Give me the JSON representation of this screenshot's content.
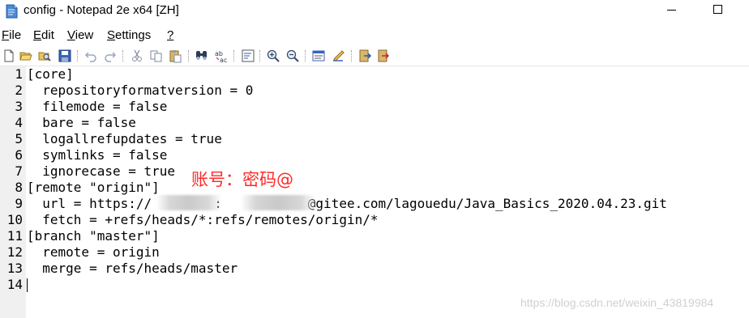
{
  "window": {
    "title": "config - Notepad 2e x64 [ZH]"
  },
  "menu": [
    {
      "label": "File",
      "accel": "F",
      "rest": "ile"
    },
    {
      "label": "Edit",
      "accel": "E",
      "rest": "dit"
    },
    {
      "label": "View",
      "accel": "V",
      "rest": "iew"
    },
    {
      "label": "Settings",
      "accel": "S",
      "rest": "ettings"
    },
    {
      "label": "?",
      "accel": "?",
      "rest": ""
    }
  ],
  "toolbar": [
    "new-file-icon",
    "open-file-icon",
    "browse-icon",
    "save-icon",
    "undo-icon",
    "redo-icon",
    "cut-icon",
    "copy-icon",
    "paste-icon",
    "find-icon",
    "replace-icon",
    "word-wrap-icon",
    "zoom-in-icon",
    "zoom-out-icon",
    "scheme-icon",
    "customize-scheme-icon",
    "exit-icon",
    "save-as-icon"
  ],
  "editor": {
    "lines": [
      {
        "n": "1",
        "text": "[core]"
      },
      {
        "n": "2",
        "text": "  repositoryformatversion = 0"
      },
      {
        "n": "3",
        "text": "  filemode = false"
      },
      {
        "n": "4",
        "text": "  bare = false"
      },
      {
        "n": "5",
        "text": "  logallrefupdates = true"
      },
      {
        "n": "6",
        "text": "  symlinks = false"
      },
      {
        "n": "7",
        "text": "  ignorecase = true"
      },
      {
        "n": "8",
        "text": "[remote \"origin\"]"
      },
      {
        "n": "9",
        "text": "  url = https://        :           @gitee.com/lagouedu/Java_Basics_2020.04.23.git"
      },
      {
        "n": "10",
        "text": "  fetch = +refs/heads/*:refs/remotes/origin/*"
      },
      {
        "n": "11",
        "text": "[branch \"master\"]"
      },
      {
        "n": "12",
        "text": "  remote = origin"
      },
      {
        "n": "13",
        "text": "  merge = refs/heads/master"
      },
      {
        "n": "14",
        "text": ""
      }
    ]
  },
  "annotation": "账号：密码@",
  "watermark": "https://blog.csdn.net/weixin_43819984",
  "colors": {
    "annotation": "#ff2a2a",
    "gutter": "#f0f0f0"
  }
}
